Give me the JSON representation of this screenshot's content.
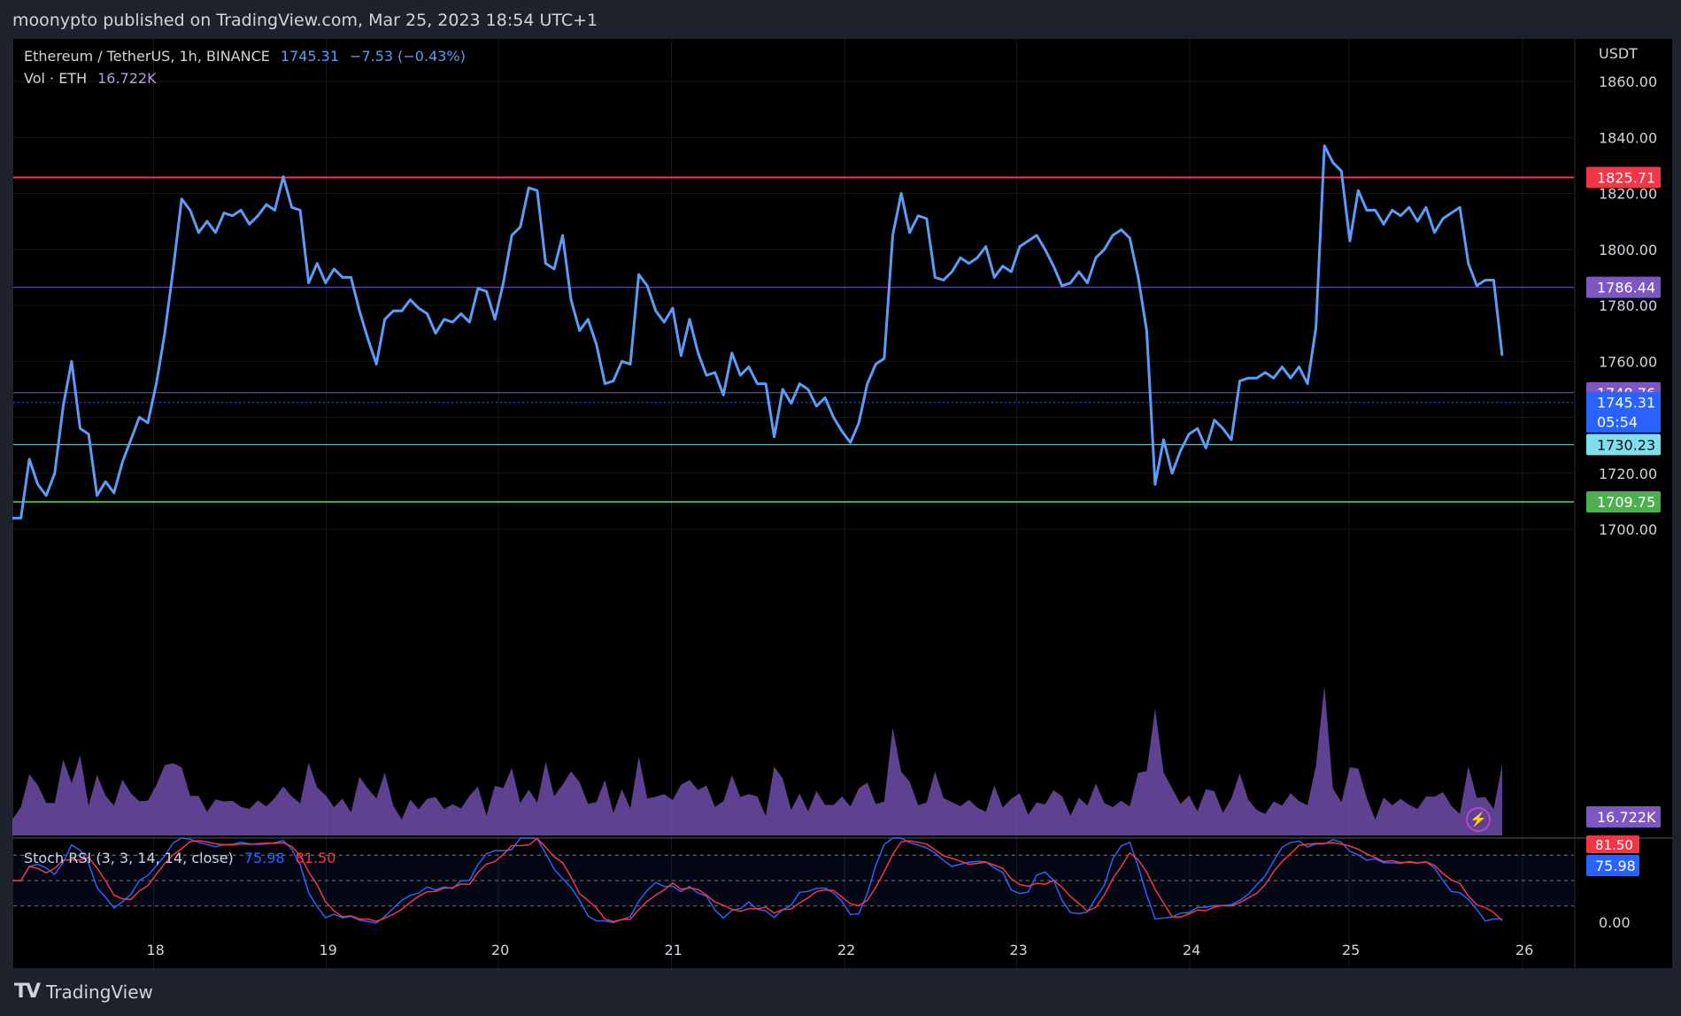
{
  "header": {
    "published": "moonypto published on TradingView.com, Mar 25, 2023 18:54 UTC+1"
  },
  "legend": {
    "symbol": "Ethereum / TetherUS, 1h, BINANCE",
    "price": "1745.31",
    "change": "−7.53 (−0.43%)",
    "volume_label": "Vol · ETH",
    "volume_value": "16.722K"
  },
  "rsi_legend": {
    "label": "Stoch RSI (3, 3, 14, 14, close)",
    "k_value": "75.98",
    "d_value": "81.50"
  },
  "axis": {
    "currency": "USDT",
    "countdown": "05:54"
  },
  "brand": {
    "name": "TradingView"
  },
  "colors": {
    "line": "#5b9cf6",
    "background": "#000000",
    "volume": "#7e57c2",
    "resistance": "#f23645",
    "support": "#4caf50",
    "mid_purple": "#7e57c2",
    "mid_teal": "#80deea",
    "stoch_k": "#2962ff",
    "stoch_d": "#f23645"
  },
  "chart_data": [
    {
      "type": "line",
      "title": "Ethereum / TetherUS, 1h, BINANCE",
      "x_ticks": [
        "18",
        "19",
        "20",
        "21",
        "22",
        "23",
        "24",
        "25",
        "26"
      ],
      "y_ticks": [
        1700,
        1720,
        1740,
        1760,
        1780,
        1800,
        1820,
        1840,
        1860,
        1880
      ],
      "y_tick_labels": [
        "1700.00",
        "1720.00",
        "",
        "1760.00",
        "1780.00",
        "1800.00",
        "1820.00",
        "1840.00",
        "1860.00",
        ""
      ],
      "ylim": [
        1600,
        1870
      ],
      "x_range": [
        17.2,
        26.2
      ],
      "series": [
        {
          "values": [
            [
              17.2,
              1704
            ],
            [
              17.25,
              1704
            ],
            [
              17.3,
              1725
            ],
            [
              17.35,
              1716
            ],
            [
              17.4,
              1712
            ],
            [
              17.45,
              1720
            ],
            [
              17.5,
              1744
            ],
            [
              17.55,
              1760
            ],
            [
              17.6,
              1736
            ],
            [
              17.65,
              1734
            ],
            [
              17.7,
              1712
            ],
            [
              17.75,
              1717
            ],
            [
              17.8,
              1713
            ],
            [
              17.85,
              1724
            ],
            [
              17.9,
              1732
            ],
            [
              17.95,
              1740
            ],
            [
              18.0,
              1738
            ],
            [
              18.05,
              1752
            ],
            [
              18.1,
              1770
            ],
            [
              18.15,
              1793
            ],
            [
              18.2,
              1818
            ],
            [
              18.25,
              1814
            ],
            [
              18.3,
              1806
            ],
            [
              18.35,
              1810
            ],
            [
              18.4,
              1806
            ],
            [
              18.45,
              1813
            ],
            [
              18.5,
              1812
            ],
            [
              18.55,
              1814
            ],
            [
              18.6,
              1809
            ],
            [
              18.65,
              1812
            ],
            [
              18.7,
              1816
            ],
            [
              18.75,
              1814
            ],
            [
              18.8,
              1826
            ],
            [
              18.85,
              1815
            ],
            [
              18.9,
              1814
            ],
            [
              18.95,
              1788
            ],
            [
              19.0,
              1795
            ],
            [
              19.05,
              1788
            ],
            [
              19.1,
              1793
            ],
            [
              19.15,
              1790
            ],
            [
              19.2,
              1790
            ],
            [
              19.25,
              1778
            ],
            [
              19.3,
              1768
            ],
            [
              19.35,
              1759
            ],
            [
              19.4,
              1775
            ],
            [
              19.45,
              1778
            ],
            [
              19.5,
              1778
            ],
            [
              19.55,
              1782
            ],
            [
              19.6,
              1779
            ],
            [
              19.65,
              1777
            ],
            [
              19.7,
              1770
            ],
            [
              19.75,
              1775
            ],
            [
              19.8,
              1774
            ],
            [
              19.85,
              1777
            ],
            [
              19.9,
              1774
            ],
            [
              19.95,
              1786
            ],
            [
              20.0,
              1785
            ],
            [
              20.05,
              1775
            ],
            [
              20.1,
              1788
            ],
            [
              20.15,
              1805
            ],
            [
              20.2,
              1808
            ],
            [
              20.25,
              1822
            ],
            [
              20.3,
              1821
            ],
            [
              20.35,
              1795
            ],
            [
              20.4,
              1793
            ],
            [
              20.45,
              1805
            ],
            [
              20.5,
              1782
            ],
            [
              20.55,
              1771
            ],
            [
              20.6,
              1775
            ],
            [
              20.65,
              1766
            ],
            [
              20.7,
              1752
            ],
            [
              20.75,
              1753
            ],
            [
              20.8,
              1760
            ],
            [
              20.85,
              1759
            ],
            [
              20.9,
              1791
            ],
            [
              20.95,
              1787
            ],
            [
              21.0,
              1778
            ],
            [
              21.05,
              1774
            ],
            [
              21.1,
              1779
            ],
            [
              21.15,
              1762
            ],
            [
              21.2,
              1775
            ],
            [
              21.25,
              1763
            ],
            [
              21.3,
              1755
            ],
            [
              21.35,
              1756
            ],
            [
              21.4,
              1748
            ],
            [
              21.45,
              1763
            ],
            [
              21.5,
              1755
            ],
            [
              21.55,
              1758
            ],
            [
              21.6,
              1752
            ],
            [
              21.65,
              1752
            ],
            [
              21.7,
              1733
            ],
            [
              21.75,
              1750
            ],
            [
              21.8,
              1745
            ],
            [
              21.85,
              1752
            ],
            [
              21.9,
              1750
            ],
            [
              21.95,
              1744
            ],
            [
              22.0,
              1747
            ],
            [
              22.05,
              1740
            ],
            [
              22.1,
              1735
            ],
            [
              22.15,
              1731
            ],
            [
              22.2,
              1738
            ],
            [
              22.25,
              1752
            ],
            [
              22.3,
              1759
            ],
            [
              22.35,
              1761
            ],
            [
              22.4,
              1805
            ],
            [
              22.45,
              1820
            ],
            [
              22.5,
              1806
            ],
            [
              22.55,
              1812
            ],
            [
              22.6,
              1811
            ],
            [
              22.65,
              1790
            ],
            [
              22.7,
              1789
            ],
            [
              22.75,
              1792
            ],
            [
              22.8,
              1797
            ],
            [
              22.85,
              1795
            ],
            [
              22.9,
              1797
            ],
            [
              22.95,
              1801
            ],
            [
              23.0,
              1790
            ],
            [
              23.05,
              1794
            ],
            [
              23.1,
              1792
            ],
            [
              23.15,
              1801
            ],
            [
              23.2,
              1803
            ],
            [
              23.25,
              1805
            ],
            [
              23.3,
              1800
            ],
            [
              23.35,
              1794
            ],
            [
              23.4,
              1787
            ],
            [
              23.45,
              1788
            ],
            [
              23.5,
              1792
            ],
            [
              23.55,
              1788
            ],
            [
              23.6,
              1797
            ],
            [
              23.65,
              1800
            ],
            [
              23.7,
              1805
            ],
            [
              23.75,
              1807
            ],
            [
              23.8,
              1804
            ],
            [
              23.85,
              1790
            ],
            [
              23.9,
              1771
            ],
            [
              23.95,
              1716
            ],
            [
              24.0,
              1732
            ],
            [
              24.05,
              1720
            ],
            [
              24.1,
              1728
            ],
            [
              24.15,
              1734
            ],
            [
              24.2,
              1736
            ],
            [
              24.25,
              1729
            ],
            [
              24.3,
              1739
            ],
            [
              24.35,
              1736
            ],
            [
              24.4,
              1732
            ],
            [
              24.45,
              1753
            ],
            [
              24.5,
              1754
            ],
            [
              24.55,
              1754
            ],
            [
              24.6,
              1756
            ],
            [
              24.65,
              1754
            ],
            [
              24.7,
              1758
            ],
            [
              24.75,
              1754
            ],
            [
              24.8,
              1758
            ],
            [
              24.85,
              1752
            ],
            [
              24.9,
              1772
            ],
            [
              24.95,
              1837
            ],
            [
              25.0,
              1831
            ],
            [
              25.05,
              1828
            ],
            [
              25.1,
              1803
            ],
            [
              25.15,
              1821
            ],
            [
              25.2,
              1814
            ],
            [
              25.25,
              1814
            ],
            [
              25.3,
              1809
            ],
            [
              25.35,
              1814
            ],
            [
              25.4,
              1812
            ],
            [
              25.45,
              1815
            ],
            [
              25.5,
              1810
            ],
            [
              25.55,
              1815
            ],
            [
              25.6,
              1806
            ],
            [
              25.65,
              1811
            ],
            [
              25.7,
              1813
            ],
            [
              25.75,
              1815
            ],
            [
              25.8,
              1795
            ],
            [
              25.85,
              1787
            ],
            [
              25.9,
              1789
            ],
            [
              25.95,
              1789
            ],
            [
              26.0,
              1762
            ]
          ]
        }
      ]
    },
    {
      "type": "area",
      "title": "Vol · ETH",
      "last_value": "16.722K"
    },
    {
      "type": "line",
      "title": "Stoch RSI (3, 3, 14, 14, close)",
      "y_ticks": [
        0
      ],
      "y_tick_labels": [
        "0.00"
      ],
      "ylim": [
        0,
        100
      ],
      "series": [
        {
          "name": "K",
          "last": 75.98
        },
        {
          "name": "D",
          "last": 81.5
        }
      ]
    }
  ],
  "horizontal_lines": [
    {
      "value": 1825.71,
      "label": "1825.71",
      "color": "#f23645"
    },
    {
      "value": 1786.44,
      "label": "1786.44",
      "color": "#7e57c2"
    },
    {
      "value": 1748.76,
      "label": "1748.76",
      "color": "#7e57c2"
    },
    {
      "value": 1745.31,
      "label": "1745.31",
      "color": "#2962ff"
    },
    {
      "value": 1730.23,
      "label": "1730.23",
      "color": "#80deea"
    },
    {
      "value": 1709.75,
      "label": "1709.75",
      "color": "#4caf50"
    }
  ],
  "price_labels": {
    "volume_tag": "16.722K",
    "rsi_d_tag": "81.50",
    "rsi_k_tag": "75.98"
  }
}
